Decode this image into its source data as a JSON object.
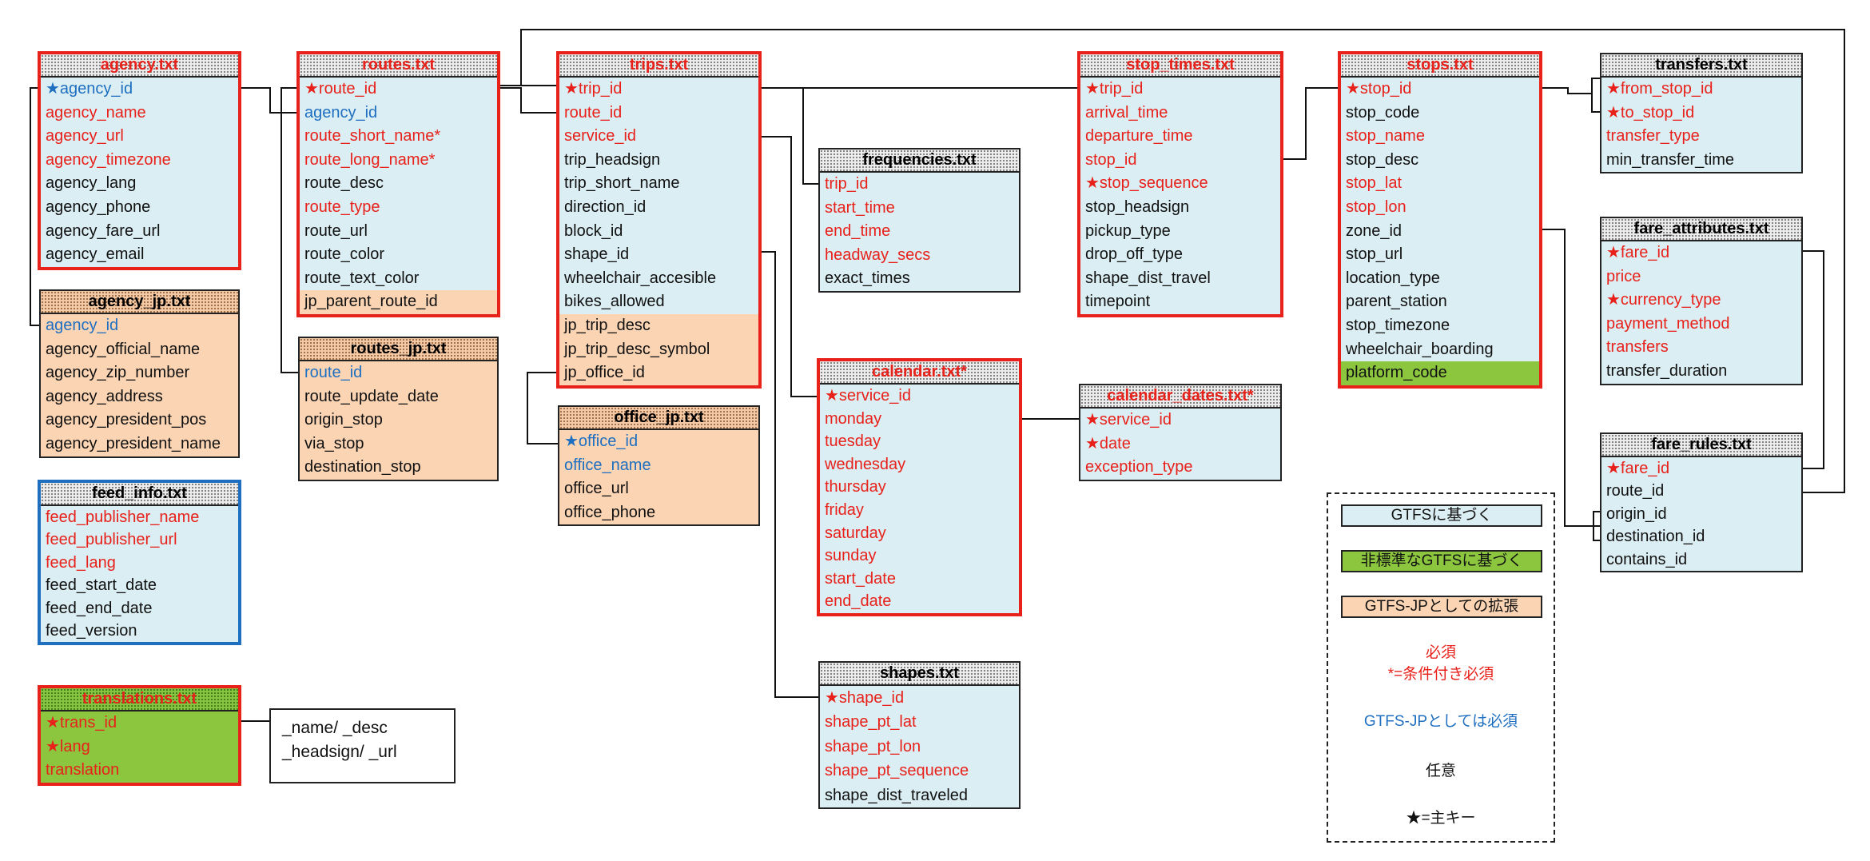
{
  "tables": {
    "agency": {
      "title": "agency.txt",
      "rows": [
        "★agency_id",
        "agency_name",
        "agency_url",
        "agency_timezone",
        "agency_lang",
        "agency_phone",
        "agency_fare_url",
        "agency_email"
      ]
    },
    "agency_jp": {
      "title": "agency_jp.txt",
      "rows": [
        "agency_id",
        "agency_official_name",
        "agency_zip_number",
        "agency_address",
        "agency_president_pos",
        "agency_president_name"
      ]
    },
    "feed_info": {
      "title": "feed_info.txt",
      "rows": [
        "feed_publisher_name",
        "feed_publisher_url",
        "feed_lang",
        "feed_start_date",
        "feed_end_date",
        "feed_version"
      ]
    },
    "translations": {
      "title": "translations.txt",
      "rows": [
        "★trans_id",
        "★lang",
        "translation"
      ]
    },
    "routes": {
      "title": "routes.txt",
      "rows": [
        "★route_id",
        "agency_id",
        "route_short_name*",
        "route_long_name*",
        "route_desc",
        "route_type",
        "route_url",
        "route_color",
        "route_text_color",
        "jp_parent_route_id"
      ]
    },
    "routes_jp": {
      "title": "routes_jp.txt",
      "rows": [
        "route_id",
        "route_update_date",
        "origin_stop",
        "via_stop",
        "destination_stop"
      ]
    },
    "trips": {
      "title": "trips.txt",
      "rows": [
        "★trip_id",
        "route_id",
        "service_id",
        "trip_headsign",
        "trip_short_name",
        "direction_id",
        "block_id",
        "shape_id",
        "wheelchair_accesible",
        "bikes_allowed",
        "jp_trip_desc",
        "jp_trip_desc_symbol",
        "jp_office_id"
      ]
    },
    "office_jp": {
      "title": "office_jp.txt",
      "rows": [
        "★office_id",
        "office_name",
        "office_url",
        "office_phone"
      ]
    },
    "frequencies": {
      "title": "frequencies.txt",
      "rows": [
        "trip_id",
        "start_time",
        "end_time",
        "headway_secs",
        "exact_times"
      ]
    },
    "calendar": {
      "title": "calendar.txt*",
      "rows": [
        "★service_id",
        "monday",
        "tuesday",
        "wednesday",
        "thursday",
        "friday",
        "saturday",
        "sunday",
        "start_date",
        "end_date"
      ]
    },
    "shapes": {
      "title": "shapes.txt",
      "rows": [
        "★shape_id",
        "shape_pt_lat",
        "shape_pt_lon",
        "shape_pt_sequence",
        "shape_dist_traveled"
      ]
    },
    "stop_times": {
      "title": "stop_times.txt",
      "rows": [
        "★trip_id",
        "arrival_time",
        "departure_time",
        "stop_id",
        "★stop_sequence",
        "stop_headsign",
        "pickup_type",
        "drop_off_type",
        "shape_dist_travel",
        "timepoint"
      ]
    },
    "calendar_dates": {
      "title": "calendar_dates.txt*",
      "rows": [
        "★service_id",
        "★date",
        "exception_type"
      ]
    },
    "stops": {
      "title": "stops.txt",
      "rows": [
        "★stop_id",
        "stop_code",
        "stop_name",
        "stop_desc",
        "stop_lat",
        "stop_lon",
        "zone_id",
        "stop_url",
        "location_type",
        "parent_station",
        "stop_timezone",
        "wheelchair_boarding",
        "platform_code"
      ]
    },
    "transfers": {
      "title": "transfers.txt",
      "rows": [
        "★from_stop_id",
        "★to_stop_id",
        "transfer_type",
        "min_transfer_time"
      ]
    },
    "fare_attributes": {
      "title": "fare_attributes.txt",
      "rows": [
        "★fare_id",
        "price",
        "★currency_type",
        "payment_method",
        "transfers",
        "transfer_duration"
      ]
    },
    "fare_rules": {
      "title": "fare_rules.txt",
      "rows": [
        "★fare_id",
        "route_id",
        "origin_id",
        "destination_id",
        "contains_id"
      ]
    }
  },
  "translations_note": {
    "line1": "_name/ _desc",
    "line2": "_headsign/ _url"
  },
  "legend": {
    "gtfs": "GTFSに基づく",
    "nonstandard": "非標準なGTFSに基づく",
    "gtfs_jp_ext": "GTFS-JPとしての拡張",
    "required": "必須",
    "conditional": "*=条件付き必須",
    "jp_required": "GTFS-JPとしては必須",
    "optional": "任意",
    "primary_key": "★=主キー"
  },
  "colors": {
    "required_red": "#e8211b",
    "jp_required_blue": "#1f6fc1",
    "gtfs_bg": "#dbeef3",
    "jp_ext_bg": "#fbd4b4",
    "nonstandard_bg": "#8cc63f"
  }
}
